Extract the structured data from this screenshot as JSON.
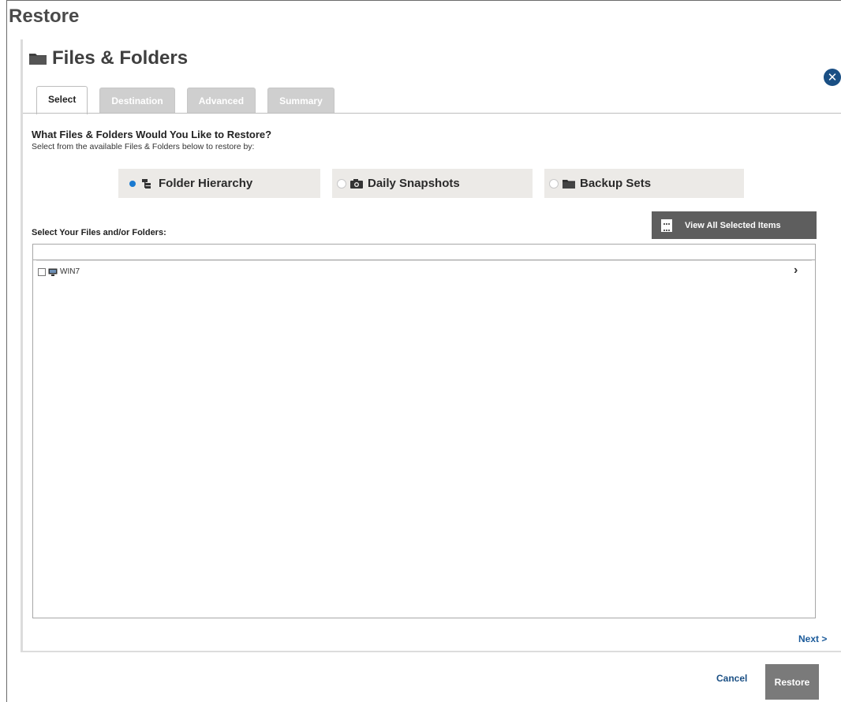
{
  "page": {
    "title": "Restore"
  },
  "panel": {
    "title": "Files & Folders"
  },
  "tabs": [
    {
      "label": "Select",
      "active": true
    },
    {
      "label": "Destination",
      "active": false
    },
    {
      "label": "Advanced",
      "active": false
    },
    {
      "label": "Summary",
      "active": false
    }
  ],
  "select": {
    "question": "What Files & Folders Would You Like to Restore?",
    "subtitle": "Select from the available Files & Folders below to restore by:",
    "options": [
      {
        "label": "Folder Hierarchy",
        "icon": "hierarchy-icon",
        "selected": true
      },
      {
        "label": "Daily Snapshots",
        "icon": "camera-icon",
        "selected": false
      },
      {
        "label": "Backup Sets",
        "icon": "folder-icon",
        "selected": false
      }
    ],
    "files_label": "Select Your Files and/or Folders:",
    "view_all_label": "View All Selected Items",
    "search_value": ""
  },
  "tree": {
    "items": [
      {
        "label": "WIN7",
        "icon": "computer-icon",
        "checked": false
      }
    ],
    "expand_glyph": "›"
  },
  "nav": {
    "next_label": "Next >"
  },
  "footer": {
    "cancel_label": "Cancel",
    "restore_label": "Restore"
  },
  "close_glyph": "✕",
  "colors": {
    "accent": "#1a4f84",
    "radio_selected": "#1a7ad0",
    "tab_inactive": "#cfcfcf",
    "button_dark": "#5e5e5e",
    "restore_button": "#7a7a7a"
  }
}
